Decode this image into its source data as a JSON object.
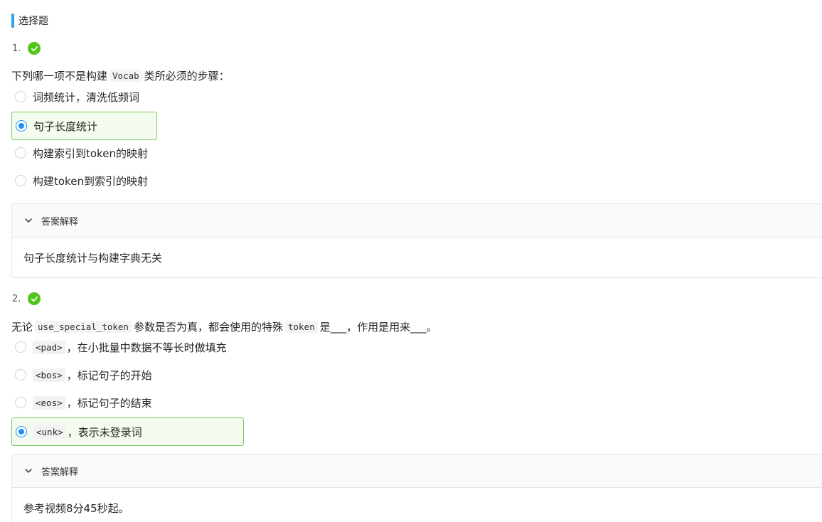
{
  "section": {
    "title": "选择题"
  },
  "questions": [
    {
      "number": "1.",
      "stem": {
        "before": "下列哪一项不是构建",
        "code1": "Vocab",
        "after": "类所必须的步骤："
      },
      "options": [
        {
          "label": "词频统计，清洗低频词",
          "selected": false
        },
        {
          "label": "句子长度统计",
          "selected": true
        },
        {
          "label": "构建索引到token的映射",
          "selected": false
        },
        {
          "label": "构建token到索引的映射",
          "selected": false
        }
      ],
      "explain": {
        "title": "答案解释",
        "body": "句子长度统计与构建字典无关"
      }
    },
    {
      "number": "2.",
      "stem": {
        "before": "无论",
        "code1": "use_special_token",
        "middle": "参数是否为真，都会使用的特殊",
        "code2": "token",
        "after": "是___，作用是用来___。"
      },
      "options": [
        {
          "code": "<pad>",
          "label": "，在小批量中数据不等长时做填充",
          "selected": false
        },
        {
          "code": "<bos>",
          "label": "，标记句子的开始",
          "selected": false
        },
        {
          "code": "<eos>",
          "label": "，标记句子的结束",
          "selected": false
        },
        {
          "code": "<unk>",
          "label": "，表示未登录词",
          "selected": true
        }
      ],
      "explain": {
        "title": "答案解释",
        "body": "参考视频8分45秒起。"
      }
    }
  ],
  "colors": {
    "accent": "#2fa3e6",
    "correct": "#52c41a",
    "selected_border": "#7dcb62",
    "radio": "#1890ff"
  }
}
